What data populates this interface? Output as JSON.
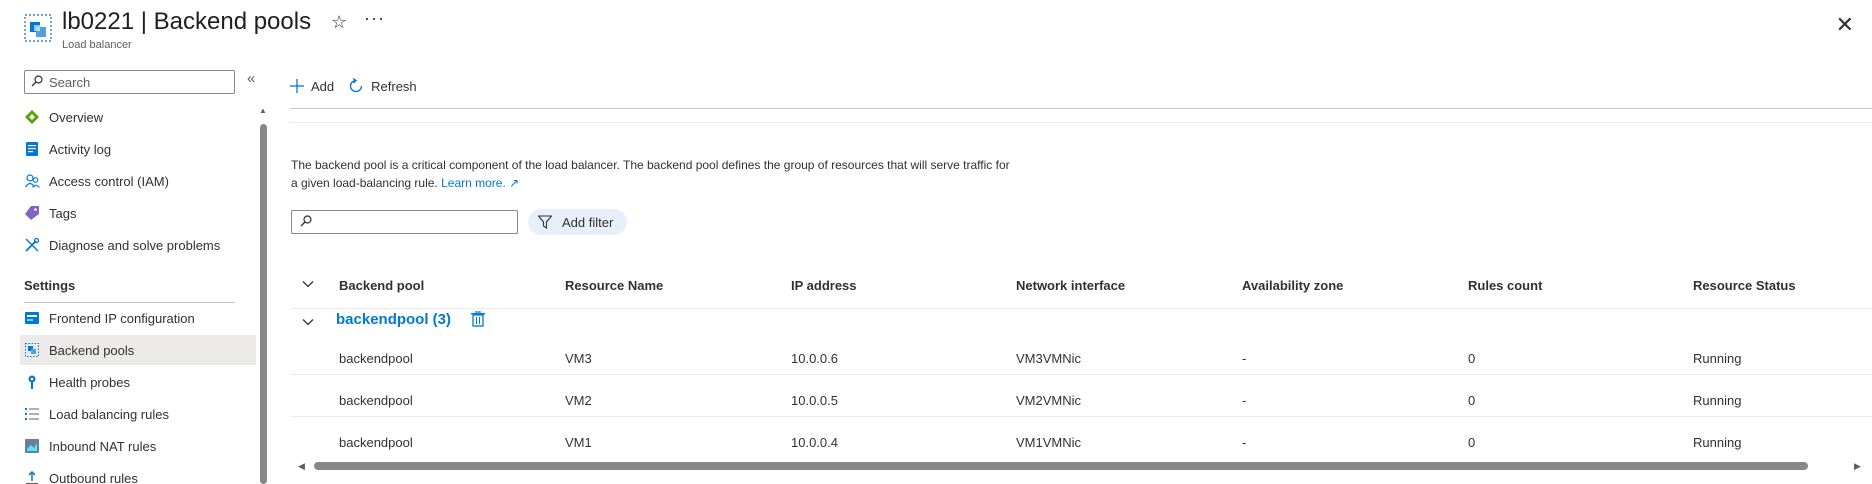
{
  "header": {
    "title": "lb0221 | Backend pools",
    "subtitle": "Load balancer",
    "favorite_icon": "star-icon",
    "more_label": "···",
    "close_label": "✕"
  },
  "sidebar": {
    "search_placeholder": "Search",
    "collapse_label": "«",
    "items": [
      {
        "label": "Overview",
        "icon": "overview-icon"
      },
      {
        "label": "Activity log",
        "icon": "activity-log-icon"
      },
      {
        "label": "Access control (IAM)",
        "icon": "people-icon"
      },
      {
        "label": "Tags",
        "icon": "tag-icon"
      },
      {
        "label": "Diagnose and solve problems",
        "icon": "wrench-icon"
      }
    ],
    "settings_label": "Settings",
    "settings_items": [
      {
        "label": "Frontend IP configuration",
        "icon": "frontend-ip-icon"
      },
      {
        "label": "Backend pools",
        "icon": "backend-pool-icon",
        "active": true
      },
      {
        "label": "Health probes",
        "icon": "health-probe-icon"
      },
      {
        "label": "Load balancing rules",
        "icon": "rules-list-icon"
      },
      {
        "label": "Inbound NAT rules",
        "icon": "nat-icon"
      },
      {
        "label": "Outbound rules",
        "icon": "outbound-icon"
      }
    ]
  },
  "toolbar": {
    "add_label": "Add",
    "refresh_label": "Refresh"
  },
  "description": {
    "text": "The backend pool is a critical component of the load balancer. The backend pool defines the group of resources that will serve traffic for a given load-balancing rule.",
    "link_label": "Learn more."
  },
  "filter": {
    "placeholder": "",
    "add_filter_label": "Add filter"
  },
  "table": {
    "columns": [
      "Backend pool",
      "Resource Name",
      "IP address",
      "Network interface",
      "Availability zone",
      "Rules count",
      "Resource Status"
    ],
    "group_label": "backendpool (3)",
    "rows": [
      [
        "backendpool",
        "VM3",
        "10.0.0.6",
        "VM3VMNic",
        "-",
        "0",
        "Running"
      ],
      [
        "backendpool",
        "VM2",
        "10.0.0.5",
        "VM2VMNic",
        "-",
        "0",
        "Running"
      ],
      [
        "backendpool",
        "VM1",
        "10.0.0.4",
        "VM1VMNic",
        "-",
        "0",
        "Running"
      ]
    ]
  },
  "colors": {
    "accent": "#0078d4",
    "active_bg": "#edebe9",
    "chip_bg": "#e7effa"
  }
}
